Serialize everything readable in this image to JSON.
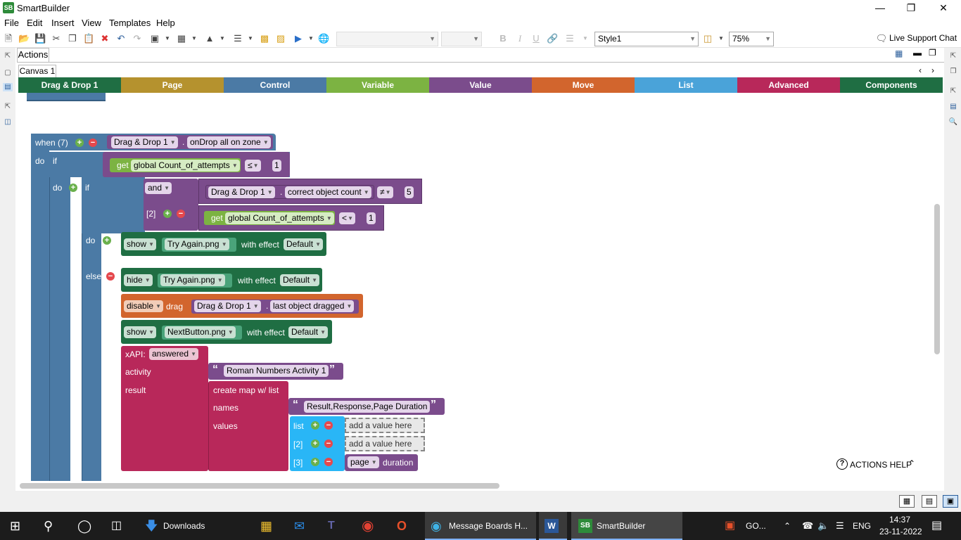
{
  "window": {
    "title": "SmartBuilder",
    "app_icon": "SB"
  },
  "menu": [
    "File",
    "Edit",
    "Insert",
    "View",
    "Templates",
    "Help"
  ],
  "toolbar": {
    "style_value": "Style1",
    "zoom_value": "75%",
    "live_support": "Live Support Chat"
  },
  "panel": {
    "actions_tab": "Actions",
    "canvas_tab": "Canvas 1"
  },
  "categories": [
    {
      "label": "Drag & Drop 1",
      "color": "#1f6e43"
    },
    {
      "label": "Page",
      "color": "#b5922e"
    },
    {
      "label": "Control",
      "color": "#4b7aa5"
    },
    {
      "label": "Variable",
      "color": "#7cb342"
    },
    {
      "label": "Value",
      "color": "#7b4c8c"
    },
    {
      "label": "Move",
      "color": "#d2652d"
    },
    {
      "label": "List",
      "color": "#4aa3d9"
    },
    {
      "label": "Advanced",
      "color": "#b8285a"
    },
    {
      "label": "Components",
      "color": "#1f6e43"
    }
  ],
  "blocks": {
    "when": {
      "label": "when (7)",
      "obj": "Drag & Drop 1",
      "event": "onDrop all on zone"
    },
    "do": "do",
    "if": "if",
    "get": "get",
    "var_attempts": "global Count_of_attempts",
    "op_le": "≤",
    "num1": "1",
    "and": "and",
    "list2": "[2]",
    "list3": "[3]",
    "dd_obj": "Drag & Drop 1",
    "correct_count": "correct object count",
    "op_ne": "≠",
    "num5": "5",
    "op_lt": "<",
    "else": "else",
    "show": "show",
    "hide": "hide",
    "try_again": "Try Again.png",
    "with_effect": "with effect",
    "default": "Default",
    "disable": "disable",
    "drag": "drag",
    "last_dragged": "last object dragged",
    "next_button": "NextButton.png",
    "xapi": "xAPI:",
    "answered": "answered",
    "activity": "activity",
    "result": "result",
    "activity_str": "Roman Numbers Activity 1",
    "create_map": "create map w/ list",
    "names": "names",
    "values": "values",
    "names_str": "Result,Response,Page Duration",
    "list": "list",
    "add_value": "add a value here",
    "page": "page",
    "duration": "duration"
  },
  "help": "ACTIONS HELP",
  "taskbar": {
    "downloads": "Downloads",
    "edge": "Message Boards H...",
    "smartbuilder": "SmartBuilder",
    "go": "GO...",
    "lang": "ENG",
    "time": "14:37",
    "date": "23-11-2022"
  }
}
